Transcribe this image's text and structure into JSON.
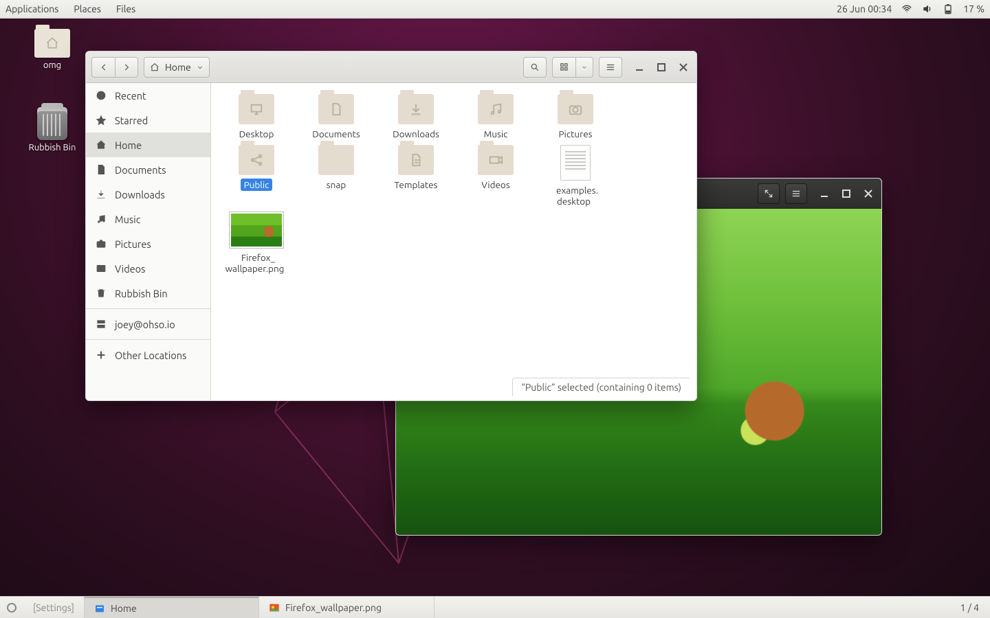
{
  "topbar": {
    "menus": [
      "Applications",
      "Places",
      "Files"
    ],
    "datetime": "26 Jun  00:34",
    "battery": "17 %"
  },
  "desktop_icons": {
    "omg": "omg",
    "bin": "Rubbish Bin"
  },
  "nautilus": {
    "path_label": "Home",
    "sidebar": {
      "recent": "Recent",
      "starred": "Starred",
      "home": "Home",
      "documents": "Documents",
      "downloads": "Downloads",
      "music": "Music",
      "pictures": "Pictures",
      "videos": "Videos",
      "trash": "Rubbish Bin",
      "remote": "joey@ohso.io",
      "other": "Other Locations"
    },
    "files": {
      "desktop": "Desktop",
      "documents": "Documents",
      "downloads": "Downloads",
      "music": "Music",
      "pictures": "Pictures",
      "public": "Public",
      "snap": "snap",
      "templates": "Templates",
      "videos": "Videos",
      "examples": "examples.\ndesktop",
      "wallpaper": "Firefox_\nwallpaper.png"
    },
    "statusbar": "“Public” selected  (containing 0 items)"
  },
  "panel": {
    "settings": "[Settings]",
    "home": "Home",
    "viewer": "Firefox_wallpaper.png",
    "pager": "1 / 4"
  }
}
